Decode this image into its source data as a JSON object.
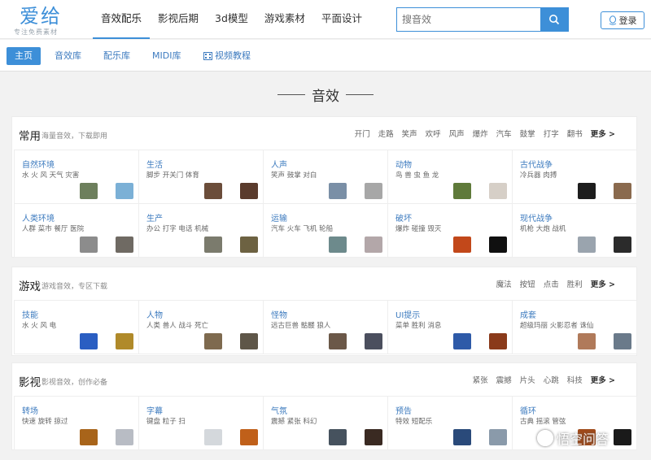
{
  "logo": {
    "text": "爱给",
    "subtitle": "专注免费素材"
  },
  "main_nav": [
    {
      "label": "音效配乐",
      "active": true
    },
    {
      "label": "影视后期"
    },
    {
      "label": "3d模型"
    },
    {
      "label": "游戏素材"
    },
    {
      "label": "平面设计"
    }
  ],
  "search": {
    "placeholder": "搜音效",
    "icon": "search-icon"
  },
  "login": {
    "label": "登录",
    "icon": "qq-icon"
  },
  "sub_nav": [
    {
      "label": "主页",
      "active": true
    },
    {
      "label": "音效库"
    },
    {
      "label": "配乐库"
    },
    {
      "label": "MIDI库"
    },
    {
      "label": "视频教程",
      "icon": "film-icon"
    }
  ],
  "page_title": "音效",
  "sections": [
    {
      "title": "常用",
      "desc": "海量音效，下载即用",
      "tags": [
        "开门",
        "走路",
        "笑声",
        "欢呼",
        "风声",
        "爆炸",
        "汽车",
        "鼓掌",
        "打字",
        "翻书"
      ],
      "more": "更多 >",
      "cards": [
        {
          "title": "自然环境",
          "sub": "水 火 风 天气 灾害",
          "thumbs": [
            "#6d7f5c",
            "#7bb0d6"
          ]
        },
        {
          "title": "生活",
          "sub": "脚步 开关门 体育",
          "thumbs": [
            "#6b4d3a",
            "#5a3b2c"
          ]
        },
        {
          "title": "人声",
          "sub": "笑声 鼓掌 对白",
          "thumbs": [
            "#7a8fa6",
            "#a7a7a7"
          ]
        },
        {
          "title": "动物",
          "sub": "鸟 兽 虫 鱼 龙",
          "thumbs": [
            "#5f7a3a",
            "#d6cfc7"
          ]
        },
        {
          "title": "古代战争",
          "sub": "冷兵器 肉搏",
          "thumbs": [
            "#1d1d1d",
            "#8a6a4e"
          ]
        },
        {
          "title": "人类环境",
          "sub": "人群 菜市 餐厅 医院",
          "thumbs": [
            "#8c8c8c",
            "#6f6a63"
          ]
        },
        {
          "title": "生产",
          "sub": "办公 打字 电话 机械",
          "thumbs": [
            "#7b7b6d",
            "#6d6242"
          ]
        },
        {
          "title": "运输",
          "sub": "汽车 火车 飞机 轮船",
          "thumbs": [
            "#6d8a8c",
            "#b3a7a9"
          ]
        },
        {
          "title": "破坏",
          "sub": "爆炸 碰撞 毁灭",
          "thumbs": [
            "#c2481a",
            "#101010"
          ]
        },
        {
          "title": "现代战争",
          "sub": "机枪 大炮 战机",
          "thumbs": [
            "#9aa4ae",
            "#2b2b2b"
          ]
        }
      ]
    },
    {
      "title": "游戏",
      "desc": "游戏音效，专区下载",
      "tags": [
        "魔法",
        "按钮",
        "点击",
        "胜利"
      ],
      "more": "更多 >",
      "cards": [
        {
          "title": "技能",
          "sub": "水 火 风 电",
          "thumbs": [
            "#2a5ec2",
            "#b08a2a"
          ]
        },
        {
          "title": "人物",
          "sub": "人类 兽人 战斗 死亡",
          "thumbs": [
            "#7e6a4f",
            "#5e5648"
          ]
        },
        {
          "title": "怪物",
          "sub": "远古巨兽 骷髅 狼人",
          "thumbs": [
            "#6b5848",
            "#4b4f5e"
          ]
        },
        {
          "title": "UI提示",
          "sub": "菜单 胜利 消息",
          "thumbs": [
            "#2e5aa8",
            "#8a3a1a"
          ]
        },
        {
          "title": "成套",
          "sub": "超级玛丽 火影忍者 诛仙",
          "thumbs": [
            "#b07a5a",
            "#6a7a8a"
          ]
        }
      ]
    },
    {
      "title": "影视",
      "desc": "影视音效，创作必备",
      "tags": [
        "紧张",
        "震撼",
        "片头",
        "心跳",
        "科技"
      ],
      "more": "更多 >",
      "cards": [
        {
          "title": "转场",
          "sub": "快速 旋转 掠过",
          "thumbs": [
            "#a8641a",
            "#b8bcc4"
          ]
        },
        {
          "title": "字幕",
          "sub": "键盘 粒子 扫",
          "thumbs": [
            "#d4d8dc",
            "#c0601a"
          ]
        },
        {
          "title": "气氛",
          "sub": "震撼 紧张 科幻",
          "thumbs": [
            "#46525e",
            "#3a2a22"
          ]
        },
        {
          "title": "预告",
          "sub": "特效 短配乐",
          "thumbs": [
            "#2a4a7a",
            "#8a9aaa"
          ]
        },
        {
          "title": "循环",
          "sub": "古典 摇滚 管弦",
          "thumbs": [
            "#a04a1a",
            "#1a1a1a"
          ]
        }
      ]
    }
  ],
  "watermark": {
    "text": "悟空问答"
  }
}
